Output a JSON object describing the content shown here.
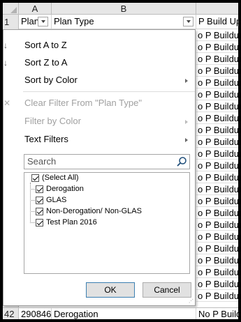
{
  "columns": {
    "a": "A",
    "b": "B"
  },
  "header_row": {
    "row_number": "1",
    "a": "Plan I",
    "b": "Plan Type",
    "c": "P Build Up"
  },
  "column_c_values": [
    "o P Buildup",
    "o P Buildup",
    "o P Buildup",
    "o P Buildup",
    "o P Buildup",
    "o P Buildup",
    "o P Buildup",
    "o P Buildup",
    "o P Buildup",
    "o P Buildup",
    "o P Buildup",
    "o P Buildup",
    "o P Buildup",
    "o P Buildup",
    "o P Buildup",
    "o P Buildup",
    "o P Buildup",
    "o P Buildup",
    "o P Buildup",
    "o P Buildup",
    "o P Buildup",
    "o P Buildup",
    "o P Buildup"
  ],
  "filter_menu": {
    "sort_az": "Sort A to Z",
    "sort_za": "Sort Z to A",
    "sort_color": "Sort by Color",
    "clear_filter": "Clear Filter From \"Plan Type\"",
    "filter_color": "Filter by Color",
    "text_filters": "Text Filters",
    "search_placeholder": "Search",
    "items": [
      {
        "label": "(Select All)",
        "checked": true
      },
      {
        "label": "Derogation",
        "checked": true
      },
      {
        "label": "GLAS",
        "checked": true
      },
      {
        "label": "Non-Derogation/ Non-GLAS",
        "checked": true
      },
      {
        "label": "Test Plan 2016",
        "checked": true
      }
    ],
    "ok_label": "OK",
    "cancel_label": "Cancel"
  },
  "bottom_row": {
    "row_number": "42",
    "a": "290846",
    "b": "Derogation",
    "c": "No P Buildup"
  }
}
